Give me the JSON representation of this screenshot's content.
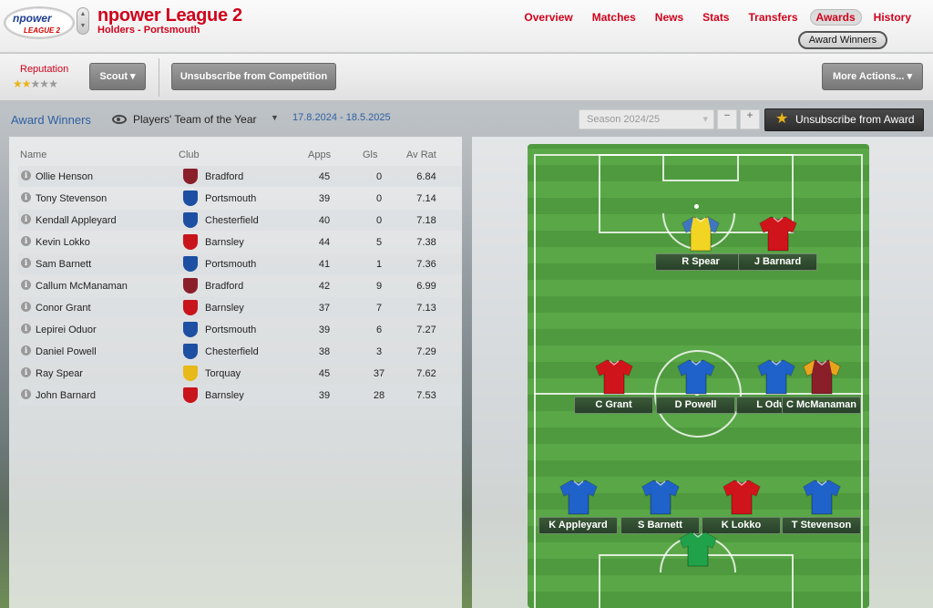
{
  "header": {
    "logo_text": "npower",
    "logo_sub": "LEAGUE 2",
    "competition_title": "npower League 2",
    "holders": "Holders - Portsmouth",
    "nav": [
      "Overview",
      "Matches",
      "News",
      "Stats",
      "Transfers",
      "Awards",
      "History"
    ],
    "active_nav": "Awards",
    "subnav_active": "Award Winners"
  },
  "toolbar": {
    "reputation_label": "Reputation",
    "reputation_stars": 2,
    "reputation_max": 5,
    "scout_label": "Scout ▾",
    "unsubscribe_competition_label": "Unsubscribe from Competition",
    "more_actions_label": "More Actions... ▾"
  },
  "award_bar": {
    "title": "Award Winners",
    "award_name": "Players' Team of the Year",
    "dates": "17.8.2024 - 18.5.2025",
    "season": "Season 2024/25",
    "minus": "−",
    "plus": "+",
    "unsubscribe_award_label": "Unsubscribe from Award"
  },
  "table": {
    "headers": {
      "name": "Name",
      "club": "Club",
      "apps": "Apps",
      "gls": "Gls",
      "avrat": "Av Rat"
    },
    "rows": [
      {
        "name": "Ollie Henson",
        "club": "Bradford",
        "apps": "45",
        "gls": "0",
        "avrat": "6.84"
      },
      {
        "name": "Tony Stevenson",
        "club": "Portsmouth",
        "apps": "39",
        "gls": "0",
        "avrat": "7.14"
      },
      {
        "name": "Kendall Appleyard",
        "club": "Chesterfield",
        "apps": "40",
        "gls": "0",
        "avrat": "7.18"
      },
      {
        "name": "Kevin Lokko",
        "club": "Barnsley",
        "apps": "44",
        "gls": "5",
        "avrat": "7.38"
      },
      {
        "name": "Sam Barnett",
        "club": "Portsmouth",
        "apps": "41",
        "gls": "1",
        "avrat": "7.36"
      },
      {
        "name": "Callum McManaman",
        "club": "Bradford",
        "apps": "42",
        "gls": "9",
        "avrat": "6.99"
      },
      {
        "name": "Conor Grant",
        "club": "Barnsley",
        "apps": "37",
        "gls": "7",
        "avrat": "7.13"
      },
      {
        "name": "Lepirei Oduor",
        "club": "Portsmouth",
        "apps": "39",
        "gls": "6",
        "avrat": "7.27"
      },
      {
        "name": "Daniel Powell",
        "club": "Chesterfield",
        "apps": "38",
        "gls": "3",
        "avrat": "7.29"
      },
      {
        "name": "Ray Spear",
        "club": "Torquay",
        "apps": "45",
        "gls": "37",
        "avrat": "7.62"
      },
      {
        "name": "John Barnard",
        "club": "Barnsley",
        "apps": "39",
        "gls": "28",
        "avrat": "7.53"
      }
    ]
  },
  "pitch": {
    "players": [
      {
        "name": "R Spear",
        "shirt": "#f2d422",
        "sleeve": "#2a6bd1"
      },
      {
        "name": "J Barnard",
        "shirt": "#d0141b",
        "sleeve": "#d0141b"
      },
      {
        "name": "C Grant",
        "shirt": "#d0141b",
        "sleeve": "#d0141b"
      },
      {
        "name": "D Powell",
        "shirt": "#1f62c9",
        "sleeve": "#1f62c9"
      },
      {
        "name": "L Oduor",
        "shirt": "#1f62c9",
        "sleeve": "#1f62c9"
      },
      {
        "name": "C McManaman",
        "shirt": "#8a1f2a",
        "sleeve": "#f2b21b"
      },
      {
        "name": "K Appleyard",
        "shirt": "#1f62c9",
        "sleeve": "#1f62c9"
      },
      {
        "name": "S Barnett",
        "shirt": "#1f62c9",
        "sleeve": "#1f62c9"
      },
      {
        "name": "K Lokko",
        "shirt": "#d0141b",
        "sleeve": "#d0141b"
      },
      {
        "name": "T Stevenson",
        "shirt": "#1f62c9",
        "sleeve": "#1f62c9"
      },
      {
        "shirt": "#1fa24a",
        "sleeve": "#1fa24a"
      }
    ]
  },
  "colors": {
    "accent": "#d0021b",
    "link": "#2d5fa3"
  },
  "icons": {
    "info": "info-icon",
    "eye": "eye-icon",
    "star": "star-icon",
    "dropdown": "chevron-down-icon"
  }
}
